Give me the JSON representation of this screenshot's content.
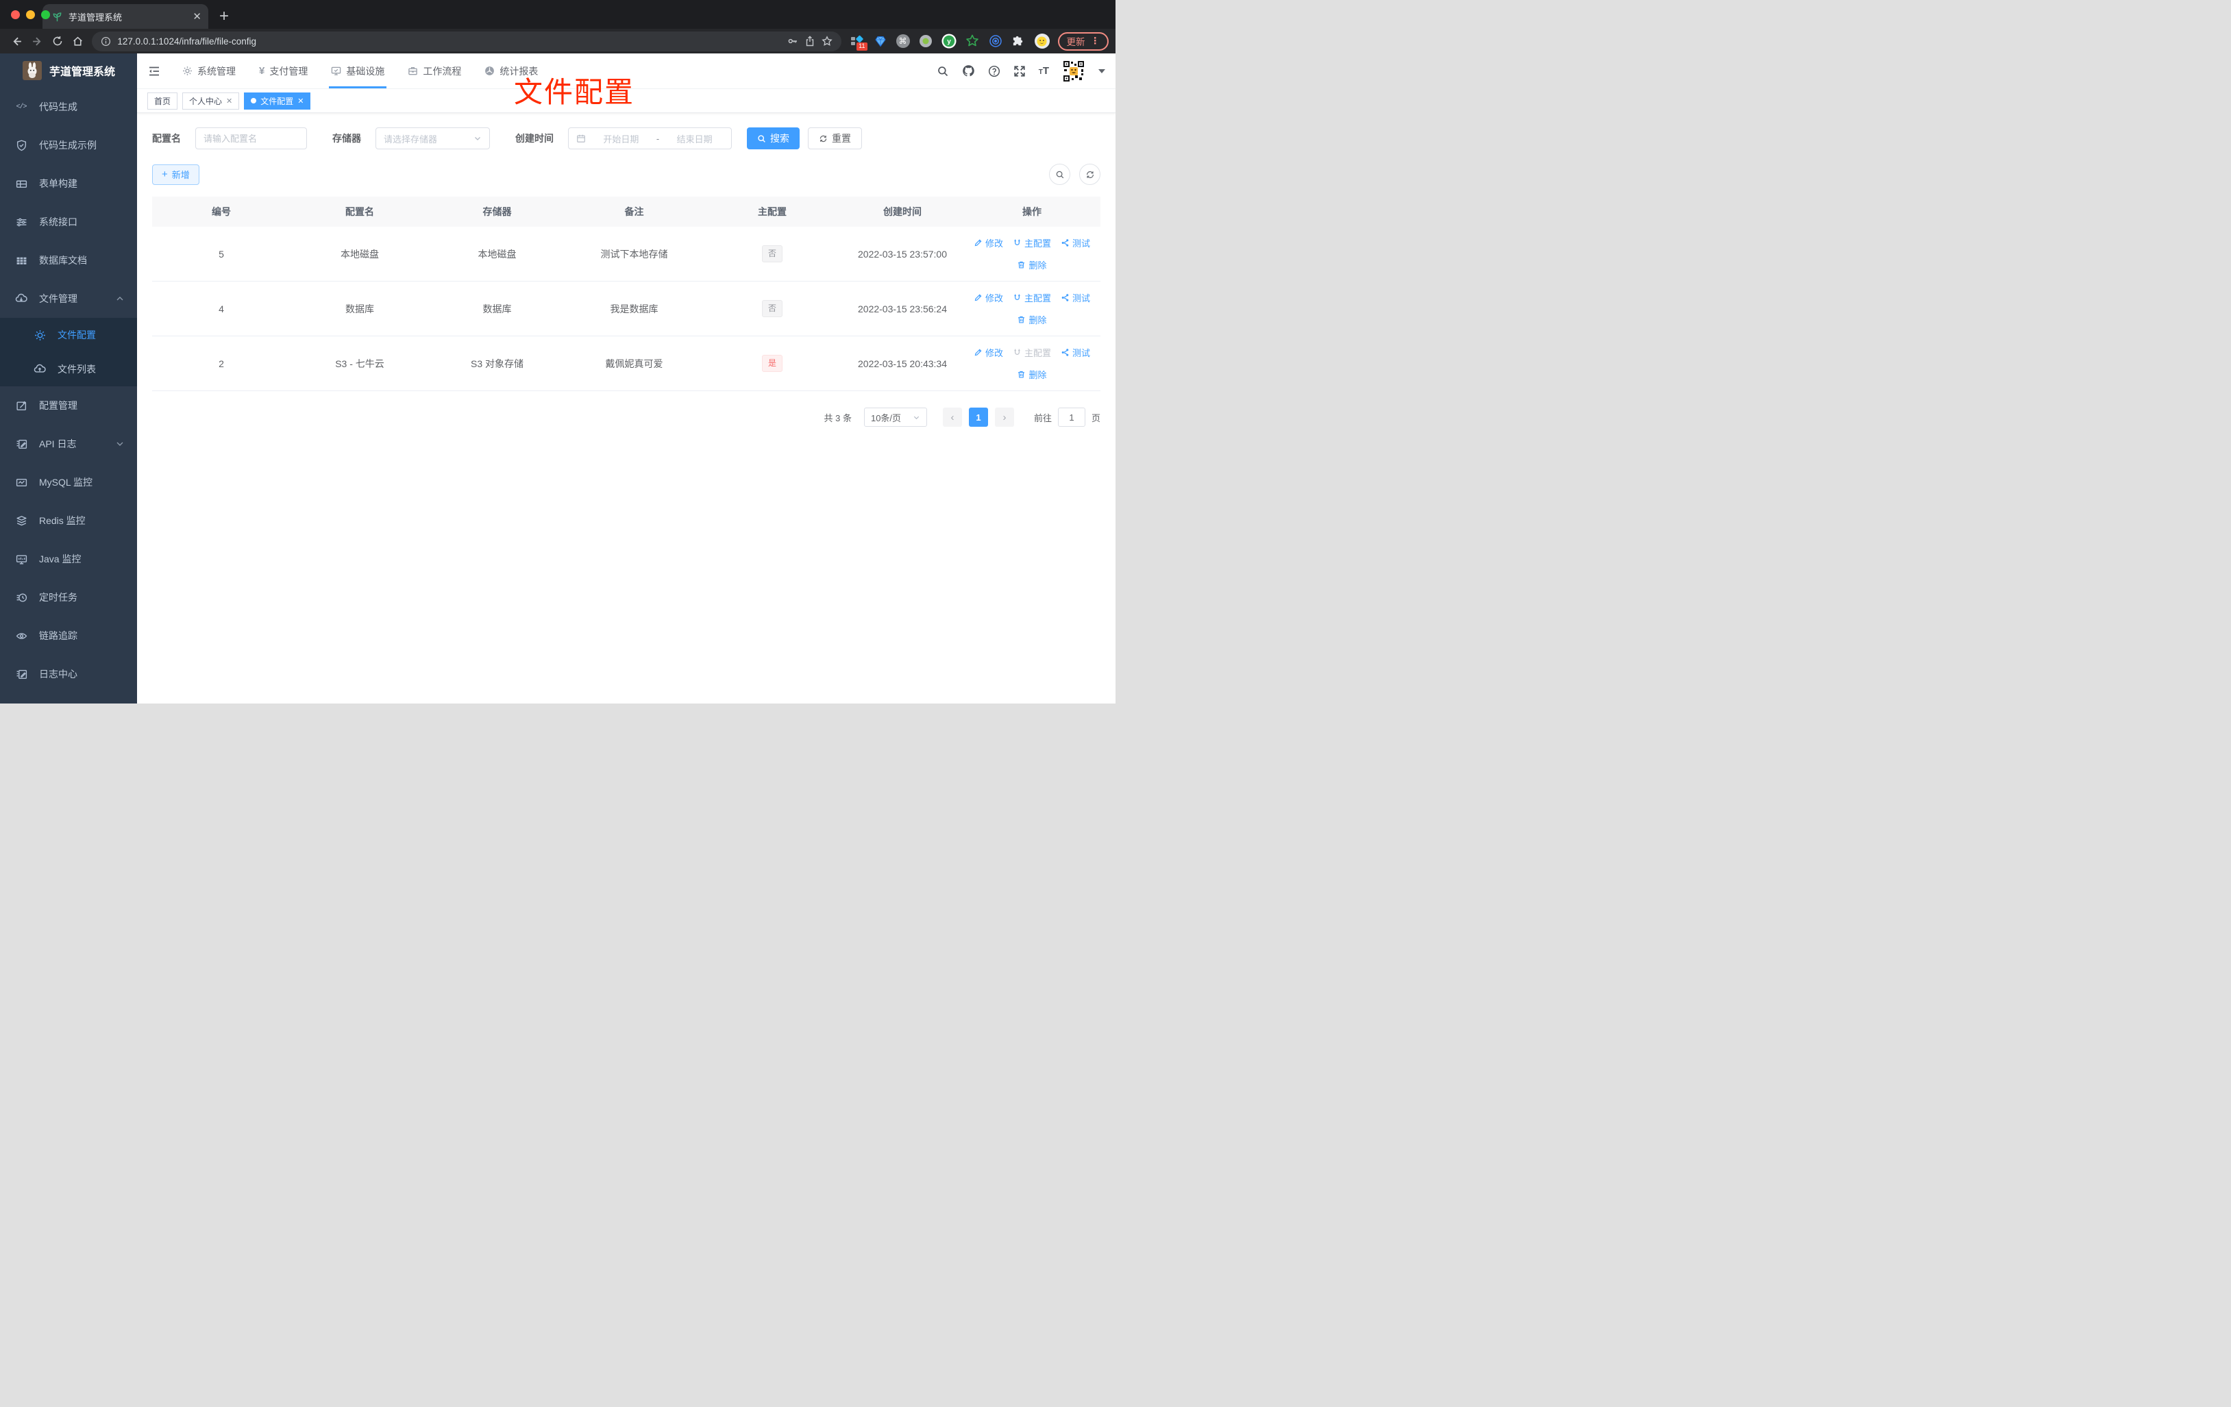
{
  "browser": {
    "tab_title": "芋道管理系统",
    "url": "127.0.0.1:1024/infra/file/file-config",
    "ext_badge": "11",
    "update_label": "更新",
    "extension_icons": [
      "squares-diamond-badge",
      "gem",
      "command-circle",
      "record-circle",
      "y-circle",
      "green-star",
      "tracker-target",
      "puzzle",
      "profile-face"
    ]
  },
  "sidebar": {
    "logo_title": "芋道管理系统",
    "items": [
      {
        "label": "代码生成",
        "icon": "code-icon"
      },
      {
        "label": "代码生成示例",
        "icon": "shield-check-icon"
      },
      {
        "label": "表单构建",
        "icon": "form-grid-icon"
      },
      {
        "label": "系统接口",
        "icon": "sliders-icon"
      },
      {
        "label": "数据库文档",
        "icon": "table-icon"
      },
      {
        "label": "文件管理",
        "icon": "cloud-download-icon",
        "expanded": true
      },
      {
        "label": "文件配置",
        "icon": "gear-icon",
        "active": true,
        "submenu": true
      },
      {
        "label": "文件列表",
        "icon": "cloud-upload-icon",
        "submenu": true
      },
      {
        "label": "配置管理",
        "icon": "edit-square-icon"
      },
      {
        "label": "API 日志",
        "icon": "document-edit-icon",
        "collapsed": true
      },
      {
        "label": "MySQL 监控",
        "icon": "chart-monitor-icon"
      },
      {
        "label": "Redis 监控",
        "icon": "layers-icon"
      },
      {
        "label": "Java 监控",
        "icon": "monitor-icon"
      },
      {
        "label": "定时任务",
        "icon": "timer-icon"
      },
      {
        "label": "链路追踪",
        "icon": "eye-icon"
      },
      {
        "label": "日志中心",
        "icon": "document-edit-icon"
      }
    ]
  },
  "topnav": {
    "items": [
      {
        "label": "系统管理",
        "icon": "gear-icon"
      },
      {
        "label": "支付管理",
        "icon": "yen-icon"
      },
      {
        "label": "基础设施",
        "icon": "monitor-check-icon",
        "active": true
      },
      {
        "label": "工作流程",
        "icon": "briefcase-icon"
      },
      {
        "label": "统计报表",
        "icon": "dashboard-icon"
      }
    ]
  },
  "tags": {
    "items": [
      {
        "label": "首页",
        "closable": false,
        "active": false
      },
      {
        "label": "个人中心",
        "closable": true,
        "active": false
      },
      {
        "label": "文件配置",
        "closable": true,
        "active": true
      }
    ]
  },
  "annotation": {
    "text": "文件配置",
    "color": "#fe2b00"
  },
  "filters": {
    "name_label": "配置名",
    "name_placeholder": "请输入配置名",
    "storage_label": "存储器",
    "storage_placeholder": "请选择存储器",
    "date_label": "创建时间",
    "date_start": "开始日期",
    "date_separator": "-",
    "date_end": "结束日期",
    "search_label": "搜索",
    "reset_label": "重置"
  },
  "toolbar": {
    "add_label": "新增"
  },
  "table": {
    "headers": [
      "编号",
      "配置名",
      "存储器",
      "备注",
      "主配置",
      "创建时间",
      "操作"
    ],
    "actions": {
      "edit": "修改",
      "master": "主配置",
      "test": "测试",
      "delete": "删除"
    },
    "rows": [
      {
        "id": "5",
        "name": "本地磁盘",
        "storage": "本地磁盘",
        "remark": "测试下本地存储",
        "master": "否",
        "master_type": "info",
        "created": "2022-03-15 23:57:00",
        "master_action_disabled": false
      },
      {
        "id": "4",
        "name": "数据库",
        "storage": "数据库",
        "remark": "我是数据库",
        "master": "否",
        "master_type": "info",
        "created": "2022-03-15 23:56:24",
        "master_action_disabled": false
      },
      {
        "id": "2",
        "name": "S3 - 七牛云",
        "storage": "S3 对象存储",
        "remark": "戴佩妮真可爱",
        "master": "是",
        "master_type": "danger",
        "created": "2022-03-15 20:43:34",
        "master_action_disabled": true
      }
    ]
  },
  "pagination": {
    "total": "共 3 条",
    "page_size": "10条/页",
    "current": "1",
    "goto_label": "前往",
    "goto_value": "1",
    "page_unit": "页"
  },
  "colors": {
    "accent": "#409eff",
    "sidebar_bg": "#2d3a4b",
    "submenu_bg": "#202f3f",
    "annotation_red": "#fe2b00",
    "danger": "#f56c6c"
  }
}
